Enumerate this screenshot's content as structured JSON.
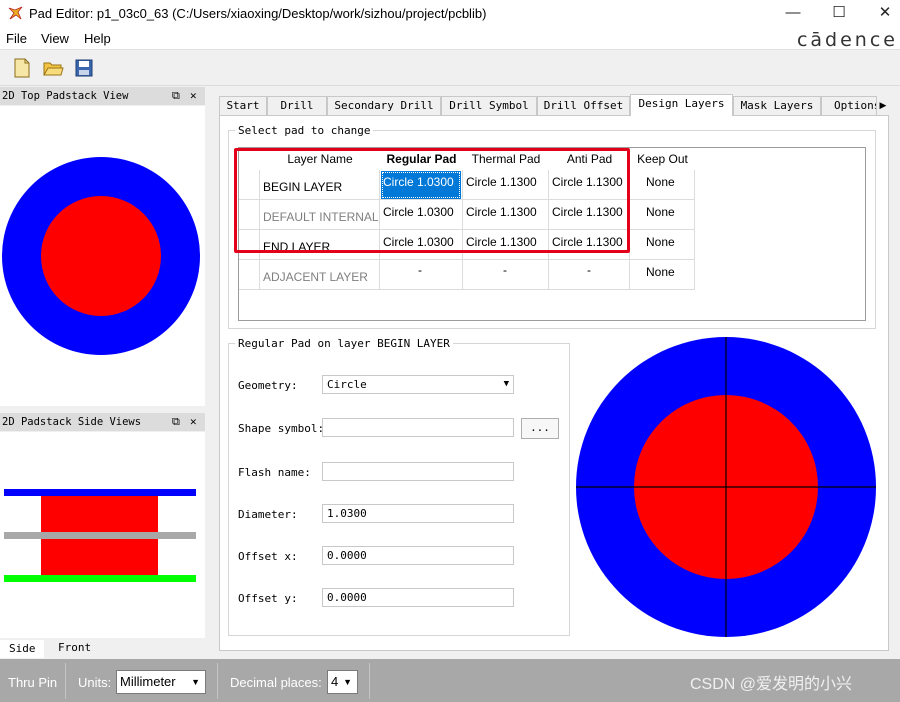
{
  "window": {
    "title": "Pad Editor: p1_03c0_63  (C:/Users/xiaoxing/Desktop/work/sizhou/project/pcblib)",
    "minimize": "—",
    "maximize": "☐",
    "close": "✕"
  },
  "menu": {
    "file": "File",
    "view": "View",
    "help": "Help",
    "brand": "cādence"
  },
  "docks": {
    "top_view_title": "2D Top Padstack View",
    "side_view_title": "2D Padstack Side Views",
    "float_glyph": "⧉",
    "close_glyph": "✕",
    "side_tabs": [
      "Side",
      "Front"
    ]
  },
  "tabs": [
    "Start",
    "Drill",
    "Secondary Drill",
    "Drill Symbol",
    "Drill Offset",
    "Design Layers",
    "Mask Layers",
    "Options"
  ],
  "tab_scroll_glyph": "▶",
  "select_group": {
    "title": "Select pad to change",
    "headers": [
      "Layer Name",
      "Regular Pad",
      "Thermal Pad",
      "Anti Pad",
      "Keep Out"
    ],
    "rows": [
      [
        "BEGIN LAYER",
        "Circle 1.0300",
        "Circle 1.1300",
        "Circle 1.1300",
        "None"
      ],
      [
        "DEFAULT INTERNAL",
        "Circle 1.0300",
        "Circle 1.1300",
        "Circle 1.1300",
        "None"
      ],
      [
        "END LAYER",
        "Circle 1.0300",
        "Circle 1.1300",
        "Circle 1.1300",
        "None"
      ],
      [
        "ADJACENT LAYER",
        "-",
        "-",
        "-",
        "None"
      ]
    ]
  },
  "pad_group": {
    "title": "Regular Pad on layer BEGIN LAYER",
    "geometry_label": "Geometry:",
    "geometry_value": "Circle",
    "shape_symbol_label": "Shape symbol:",
    "shape_symbol_value": "",
    "browse_button": "...",
    "flash_name_label": "Flash name:",
    "flash_name_value": "",
    "diameter_label": "Diameter:",
    "diameter_value": "1.0300",
    "offset_x_label": "Offset x:",
    "offset_x_value": "0.0000",
    "offset_y_label": "Offset y:",
    "offset_y_value": "0.0000"
  },
  "statusbar": {
    "mode": "Thru Pin",
    "units_label": "Units:",
    "units_value": "Millimeter",
    "decimal_label": "Decimal places:",
    "decimal_value": "4",
    "watermark": "CSDN @爱发明的小兴"
  },
  "colors": {
    "pad_outer": "#0000ff",
    "pad_inner": "#ff0000",
    "highlight": "#e3001b",
    "selection": "#0078d7",
    "side_top": "#0000ff",
    "side_mid": "#a8a8a8",
    "side_bottom": "#00ff00"
  }
}
